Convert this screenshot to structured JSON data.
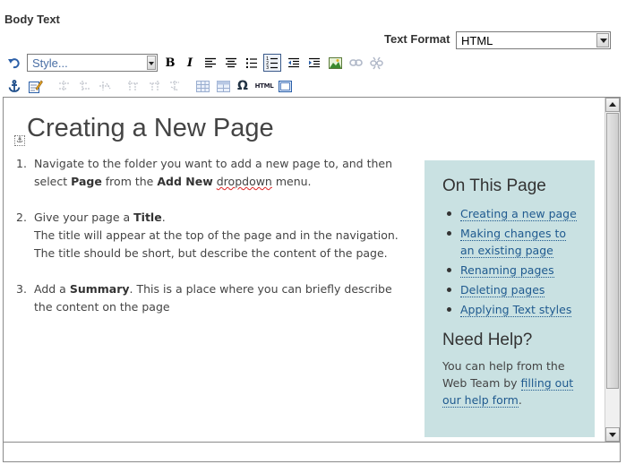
{
  "field": {
    "label": "Body Text"
  },
  "text_format": {
    "label": "Text Format",
    "value": "HTML"
  },
  "toolbar": {
    "style_placeholder": "Style...",
    "bold": "B",
    "italic": "I",
    "omega": "Ω",
    "html": "HTML"
  },
  "content": {
    "heading": "Creating a New Page",
    "steps": [
      {
        "num": "1.",
        "pre": "Navigate to the folder you want to add a new page to, and then select ",
        "b1": "Page",
        "mid": " from the ",
        "b2": "Add New",
        "sp": " ",
        "squig": "dropdown",
        "post": " menu."
      },
      {
        "num": "2.",
        "pre": "Give your page a ",
        "b1": "Title",
        "post": ".",
        "line2": "The title will appear at the top of the page and in the navigation. The title should be short, but describe the content of the page."
      },
      {
        "num": "3.",
        "pre": "Add a ",
        "b1": "Summary",
        "post": ". This is a place where you can briefly describe the content on the page"
      }
    ]
  },
  "aside": {
    "title": "On This Page",
    "links": [
      "Creating a new page",
      "Making changes to an existing page",
      "Renaming pages",
      "Deleting pages",
      "Applying Text styles"
    ],
    "help_title": "Need Help?",
    "help_pre": "You can help from the Web Team by ",
    "help_link": "filling out our help form",
    "help_post": "."
  },
  "colors": {
    "aside_bg": "#c9e1e2",
    "link": "#1f5a8f",
    "heading": "#444444"
  },
  "icons": [
    "undo-icon",
    "bold-icon",
    "italic-icon",
    "align-left-icon",
    "align-center-icon",
    "bullet-list-icon",
    "numbered-list-icon",
    "outdent-icon",
    "indent-icon",
    "insert-image-icon",
    "link-icon",
    "unlink-icon",
    "anchor-icon",
    "edit-source-icon",
    "table-icon",
    "omega-icon",
    "html-icon",
    "fullscreen-icon"
  ]
}
